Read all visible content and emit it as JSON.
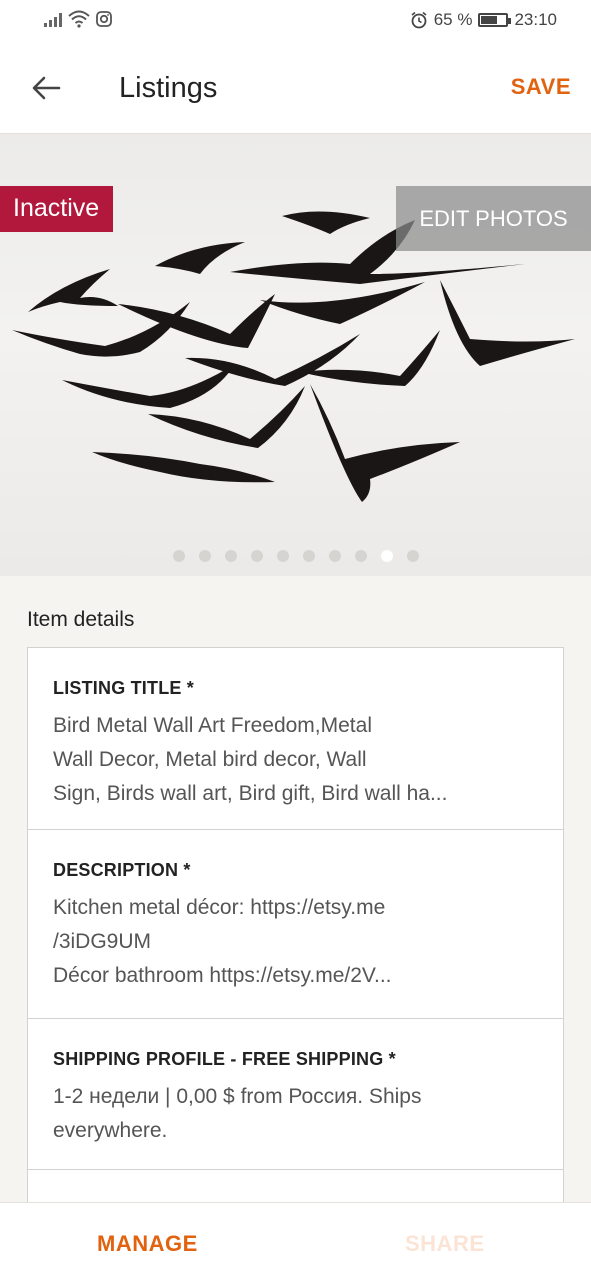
{
  "status_bar": {
    "battery": "65 %",
    "battery_level": 0.65,
    "time": "23:10"
  },
  "header": {
    "title": "Listings",
    "save_label": "SAVE"
  },
  "photo": {
    "status_badge": "Inactive",
    "edit_label": "EDIT PHOTOS",
    "dot_count": 10,
    "active_dot": 9
  },
  "item_details": {
    "section_label": "Item details",
    "listing_title": {
      "label": "LISTING TITLE *",
      "lines": [
        "Bird Metal Wall Art Freedom,Metal",
        "Wall Decor, Metal bird decor, Wall",
        "Sign, Birds wall art, Bird gift, Bird wall ha..."
      ]
    },
    "description": {
      "label": "DESCRIPTION *",
      "lines": [
        "Kitchen metal décor:  https://etsy.me",
        "/3iDG9UM",
        "Décor  bathroom        https://etsy.me/2V..."
      ]
    },
    "shipping": {
      "label": "SHIPPING PROFILE - FREE SHIPPING *",
      "lines": [
        "1-2 недели | 0,00 $ from Россия. Ships",
        "everywhere."
      ]
    }
  },
  "bottom_bar": {
    "manage_label": "MANAGE",
    "share_label": "SHARE"
  },
  "colors": {
    "accent": "#e1620f",
    "badge": "#b2183c"
  }
}
